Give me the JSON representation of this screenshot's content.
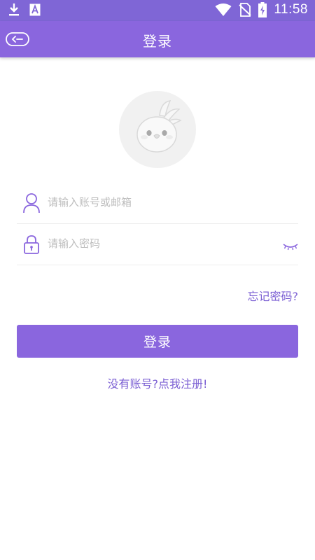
{
  "status_bar": {
    "time": "11:58",
    "icons": [
      "download-icon",
      "a-badge-icon",
      "wifi-icon",
      "no-sim-icon",
      "battery-charging-icon"
    ]
  },
  "app_bar": {
    "title": "登录",
    "back_icon": "back-arrow-icon"
  },
  "avatar": {
    "icon": "bird-avatar-icon"
  },
  "form": {
    "account_placeholder": "请输入账号或邮箱",
    "account_value": "",
    "account_icon": "user-icon",
    "password_placeholder": "请输入密码",
    "password_value": "",
    "password_icon": "lock-icon",
    "visibility_icon": "eye-closed-icon",
    "forgot_label": "忘记密码?",
    "login_label": "登录",
    "register_label": "没有账号?点我注册!"
  },
  "colors": {
    "primary": "#8a66de",
    "link": "#7b5fd3",
    "placeholder": "#bdbdbd",
    "divider": "#ededed"
  }
}
